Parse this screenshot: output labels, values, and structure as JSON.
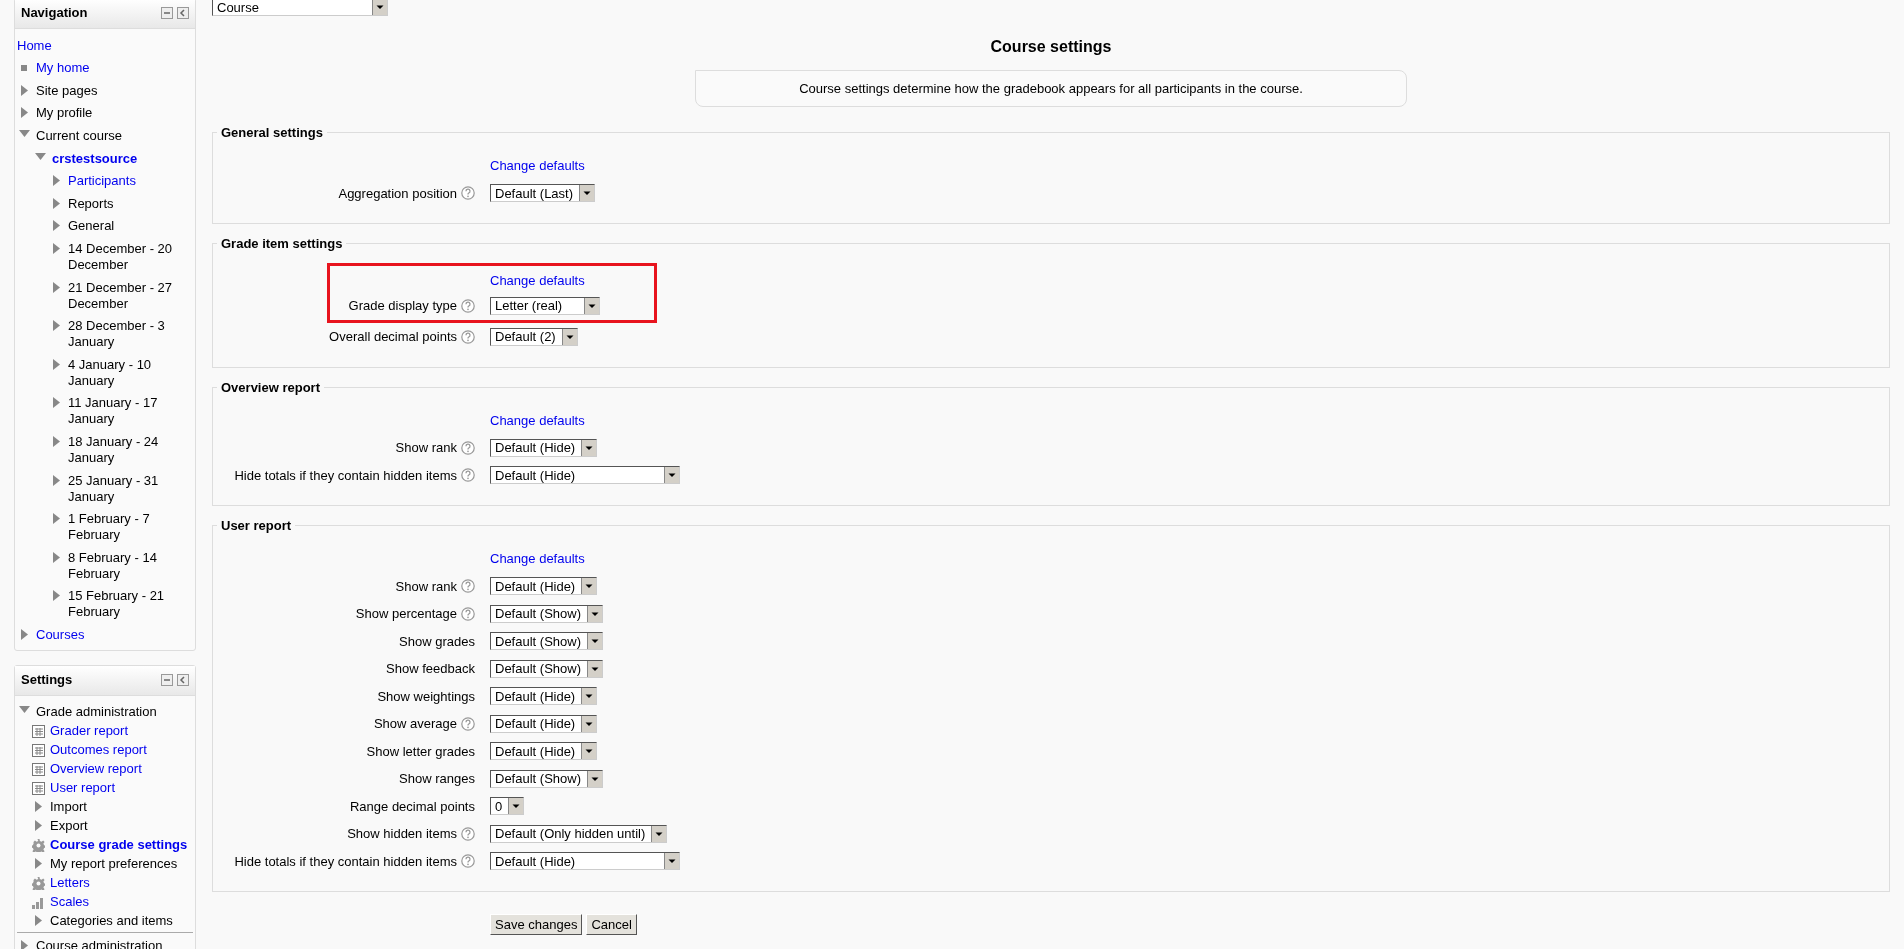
{
  "navigation": {
    "title": "Navigation",
    "home": "Home",
    "items": [
      {
        "label": "My home",
        "kind": "bullet",
        "link": true,
        "current": false
      },
      {
        "label": "Site pages",
        "kind": "collapsed",
        "link": false,
        "current": false
      },
      {
        "label": "My profile",
        "kind": "collapsed",
        "link": false,
        "current": false
      },
      {
        "label": "Current course",
        "kind": "expanded",
        "link": false,
        "current": false,
        "children": [
          {
            "label": "crstestsource",
            "kind": "expanded",
            "link": true,
            "current": true,
            "children": [
              {
                "label": "Participants",
                "kind": "collapsed",
                "link": true,
                "current": false
              },
              {
                "label": "Reports",
                "kind": "collapsed",
                "link": false,
                "current": false
              },
              {
                "label": "General",
                "kind": "collapsed",
                "link": false,
                "current": false
              },
              {
                "label": "14 December - 20 December",
                "kind": "collapsed",
                "link": false,
                "current": false
              },
              {
                "label": "21 December - 27 December",
                "kind": "collapsed",
                "link": false,
                "current": false
              },
              {
                "label": "28 December - 3 January",
                "kind": "collapsed",
                "link": false,
                "current": false
              },
              {
                "label": "4 January - 10 January",
                "kind": "collapsed",
                "link": false,
                "current": false
              },
              {
                "label": "11 January - 17 January",
                "kind": "collapsed",
                "link": false,
                "current": false
              },
              {
                "label": "18 January - 24 January",
                "kind": "collapsed",
                "link": false,
                "current": false
              },
              {
                "label": "25 January - 31 January",
                "kind": "collapsed",
                "link": false,
                "current": false
              },
              {
                "label": "1 February - 7 February",
                "kind": "collapsed",
                "link": false,
                "current": false
              },
              {
                "label": "8 February - 14 February",
                "kind": "collapsed",
                "link": false,
                "current": false
              },
              {
                "label": "15 February - 21 February",
                "kind": "collapsed",
                "link": false,
                "current": false
              }
            ]
          }
        ]
      },
      {
        "label": "Courses",
        "kind": "collapsed",
        "link": true,
        "current": false
      }
    ]
  },
  "settings": {
    "title": "Settings",
    "items": [
      {
        "label": "Grade administration",
        "kind": "expanded",
        "link": false,
        "current": false,
        "children": [
          {
            "label": "Grader report",
            "kind": "report",
            "link": true,
            "current": false
          },
          {
            "label": "Outcomes report",
            "kind": "report",
            "link": true,
            "current": false
          },
          {
            "label": "Overview report",
            "kind": "report",
            "link": true,
            "current": false
          },
          {
            "label": "User report",
            "kind": "report",
            "link": true,
            "current": false
          },
          {
            "label": "Import",
            "kind": "collapsed",
            "link": false,
            "current": false
          },
          {
            "label": "Export",
            "kind": "collapsed",
            "link": false,
            "current": false
          },
          {
            "label": "Course grade settings",
            "kind": "gear",
            "link": true,
            "current": true
          },
          {
            "label": "My report preferences",
            "kind": "collapsed",
            "link": false,
            "current": false
          },
          {
            "label": "Letters",
            "kind": "gear",
            "link": true,
            "current": false
          },
          {
            "label": "Scales",
            "kind": "chart",
            "link": true,
            "current": false
          },
          {
            "label": "Categories and items",
            "kind": "collapsed",
            "link": false,
            "current": false
          }
        ]
      },
      {
        "label": "Course administration",
        "kind": "collapsed",
        "link": false,
        "current": false
      }
    ]
  },
  "report_select": {
    "value": "Course"
  },
  "heading": "Course settings",
  "description": "Course settings determine how the gradebook appears for all participants in the course.",
  "sections": [
    {
      "title": "General settings",
      "link": "Change defaults",
      "rows": [
        {
          "label": "Aggregation position",
          "help": true,
          "value": "Default (Last)",
          "highlighted": false
        }
      ]
    },
    {
      "title": "Grade item settings",
      "link": "Change defaults",
      "rows": [
        {
          "label": "Grade display type",
          "help": true,
          "value": "Letter (real)",
          "highlighted": true
        },
        {
          "label": "Overall decimal points",
          "help": true,
          "value": "Default (2)",
          "highlighted": false
        }
      ]
    },
    {
      "title": "Overview report",
      "link": "Change defaults",
      "rows": [
        {
          "label": "Show rank",
          "help": true,
          "value": "Default (Hide)",
          "highlighted": false
        },
        {
          "label": "Hide totals if they contain hidden items",
          "help": true,
          "value": "Default (Hide)",
          "highlighted": false
        }
      ]
    },
    {
      "title": "User report",
      "link": "Change defaults",
      "rows": [
        {
          "label": "Show rank",
          "help": true,
          "value": "Default (Hide)",
          "highlighted": false
        },
        {
          "label": "Show percentage",
          "help": true,
          "value": "Default (Show)",
          "highlighted": false
        },
        {
          "label": "Show grades",
          "help": false,
          "value": "Default (Show)",
          "highlighted": false
        },
        {
          "label": "Show feedback",
          "help": false,
          "value": "Default (Show)",
          "highlighted": false
        },
        {
          "label": "Show weightings",
          "help": false,
          "value": "Default (Hide)",
          "highlighted": false
        },
        {
          "label": "Show average",
          "help": true,
          "value": "Default (Hide)",
          "highlighted": false
        },
        {
          "label": "Show letter grades",
          "help": false,
          "value": "Default (Hide)",
          "highlighted": false
        },
        {
          "label": "Show ranges",
          "help": false,
          "value": "Default (Show)",
          "highlighted": false
        },
        {
          "label": "Range decimal points",
          "help": false,
          "value": "0",
          "highlighted": false
        },
        {
          "label": "Show hidden items",
          "help": true,
          "value": "Default (Only hidden until)",
          "highlighted": false
        },
        {
          "label": "Hide totals if they contain hidden items",
          "help": true,
          "value": "Default (Hide)",
          "highlighted": false
        }
      ]
    }
  ],
  "buttons": [
    "Save changes",
    "Cancel"
  ]
}
